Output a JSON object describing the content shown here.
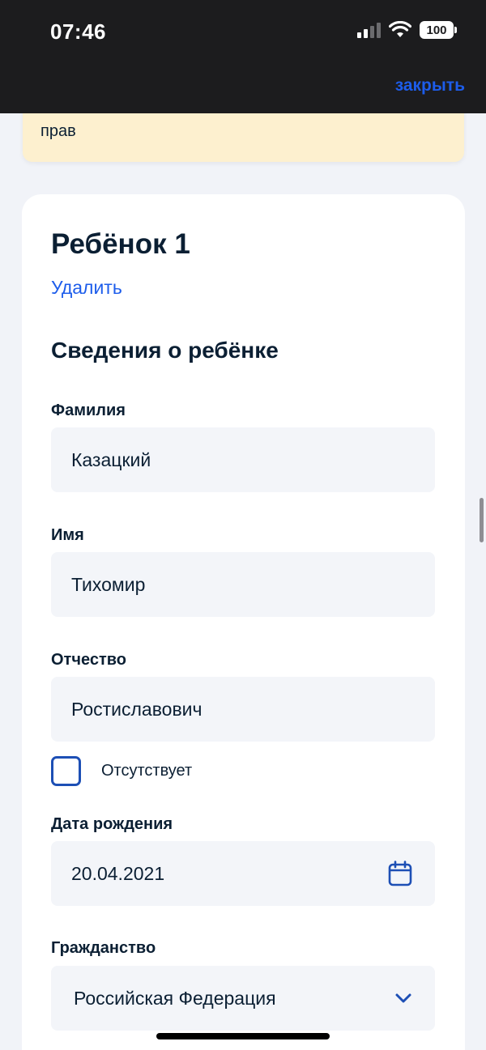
{
  "status_bar": {
    "time": "07:46",
    "battery": "100"
  },
  "header": {
    "close_label": "закрыть"
  },
  "notice": {
    "visible_text": "прав"
  },
  "card": {
    "title": "Ребёнок 1",
    "delete_label": "Удалить",
    "section_title": "Сведения о ребёнке",
    "fields": {
      "last_name": {
        "label": "Фамилия",
        "value": "Казацкий"
      },
      "first_name": {
        "label": "Имя",
        "value": "Тихомир"
      },
      "patronymic": {
        "label": "Отчество",
        "value": "Ростиславович"
      },
      "patronymic_absent": {
        "label": "Отсутствует",
        "checked": false
      },
      "birth_date": {
        "label": "Дата рождения",
        "value": "20.04.2021",
        "icon": "calendar-icon"
      },
      "citizenship": {
        "label": "Гражданство",
        "value": "Российская Федерация",
        "icon": "chevron-down-icon"
      }
    }
  },
  "colors": {
    "accent": "#1d5deb",
    "checkbox_border": "#1d4fb5",
    "notice_bg": "#fdf0cf",
    "field_bg": "#f3f5f9",
    "page_bg": "#f1f3f8",
    "text": "#0b1f33"
  }
}
